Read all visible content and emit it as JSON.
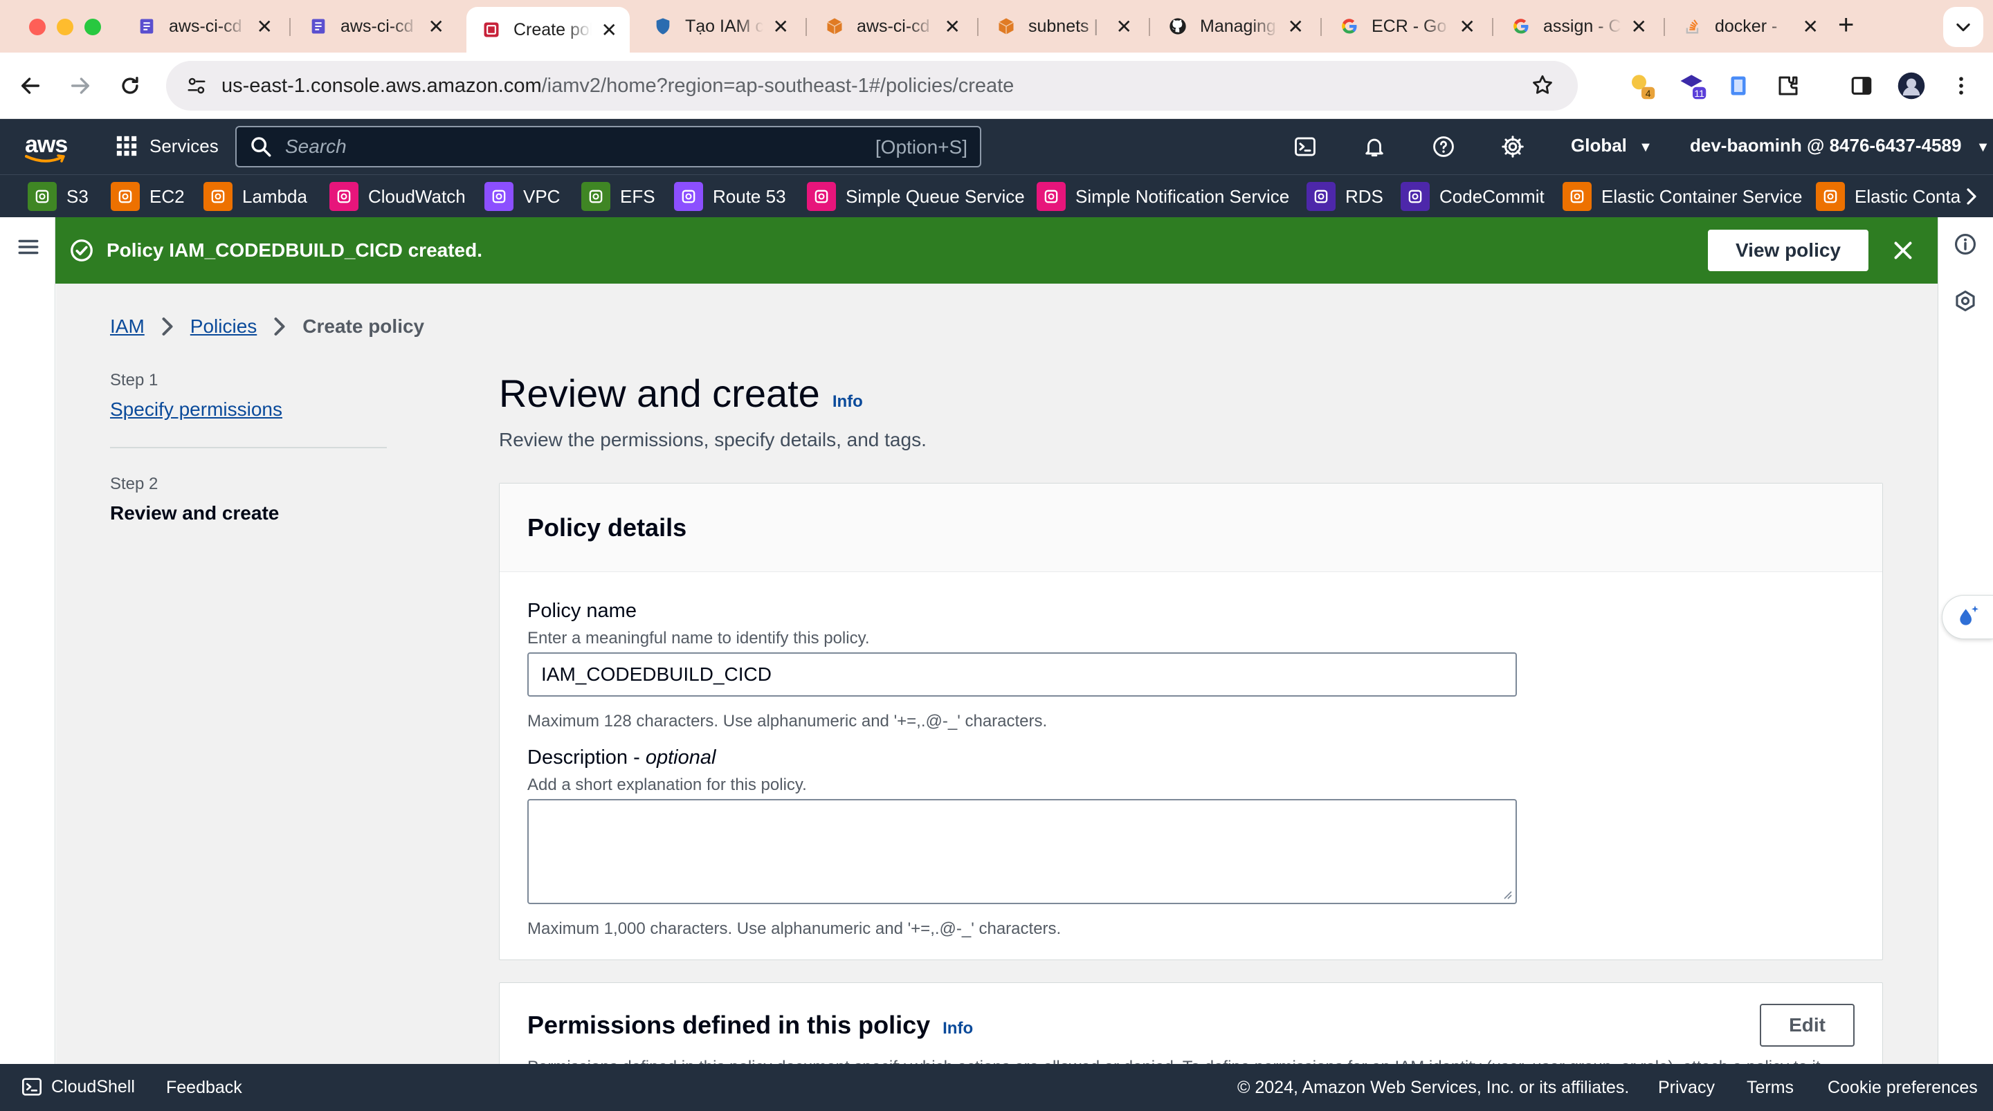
{
  "browser": {
    "tabs": [
      {
        "title": "aws-ci-cd",
        "icon": "codecommit-icon",
        "color": "#5a4fcf"
      },
      {
        "title": "aws-ci-cd",
        "icon": "codecommit-icon",
        "color": "#5a4fcf"
      },
      {
        "title": "Create policy",
        "icon": "iam-icon",
        "color": "#c7223a",
        "active": true
      },
      {
        "title": "Tạo IAM c",
        "icon": "shield-icon",
        "color": "#2b6cb0"
      },
      {
        "title": "aws-ci-cd",
        "icon": "cube-icon",
        "color": "#e07b24"
      },
      {
        "title": "subnets | ",
        "icon": "cube-icon",
        "color": "#e07b24"
      },
      {
        "title": "Managing",
        "icon": "github-icon",
        "color": "#1f1f1f"
      },
      {
        "title": "ECR - Go",
        "icon": "google-icon",
        "color": "#4285f4"
      },
      {
        "title": "assign - C",
        "icon": "google-icon",
        "color": "#4285f4"
      },
      {
        "title": "docker - ",
        "icon": "stackoverflow-icon",
        "color": "#f48024"
      }
    ],
    "url_host": "us-east-1.console.aws.amazon.com",
    "url_path": "/iamv2/home?region=ap-southeast-1#/policies/create",
    "ext_badge_1": "4",
    "ext_badge_2": "11"
  },
  "aws_nav": {
    "logo": "aws",
    "services_label": "Services",
    "search_placeholder": "Search",
    "search_shortcut": "[Option+S]",
    "region": "Global",
    "account": "dev-baominh @ 8476-6437-4589"
  },
  "favorites": [
    {
      "label": "S3",
      "color": "#3f8624"
    },
    {
      "label": "EC2",
      "color": "#ed7100"
    },
    {
      "label": "Lambda",
      "color": "#ed7100"
    },
    {
      "label": "CloudWatch",
      "color": "#e7157b"
    },
    {
      "label": "VPC",
      "color": "#8c4fff"
    },
    {
      "label": "EFS",
      "color": "#3f8624"
    },
    {
      "label": "Route 53",
      "color": "#8c4fff"
    },
    {
      "label": "Simple Queue Service",
      "color": "#e7157b"
    },
    {
      "label": "Simple Notification Service",
      "color": "#e7157b"
    },
    {
      "label": "RDS",
      "color": "#4d27aa"
    },
    {
      "label": "CodeCommit",
      "color": "#4d27aa"
    },
    {
      "label": "Elastic Container Service",
      "color": "#ed7100"
    },
    {
      "label": "Elastic Conta",
      "color": "#ed7100"
    }
  ],
  "flash": {
    "message": "Policy IAM_CODEDBUILD_CICD created.",
    "button": "View policy",
    "color": "#2e7d22"
  },
  "breadcrumbs": {
    "iam": "IAM",
    "policies": "Policies",
    "current": "Create policy"
  },
  "steps": {
    "step1_label": "Step 1",
    "step1_title": "Specify permissions",
    "step2_label": "Step 2",
    "step2_title": "Review and create"
  },
  "page": {
    "title": "Review and create",
    "info": "Info",
    "subtitle": "Review the permissions, specify details, and tags."
  },
  "policy_details": {
    "heading": "Policy details",
    "name_label": "Policy name",
    "name_desc": "Enter a meaningful name to identify this policy.",
    "name_value": "IAM_CODEDBUILD_CICD",
    "name_hint": "Maximum 128 characters. Use alphanumeric and '+=,.@-_' characters.",
    "desc_label": "Description - ",
    "desc_optional": "optional",
    "desc_desc": "Add a short explanation for this policy.",
    "desc_value": "",
    "desc_hint": "Maximum 1,000 characters. Use alphanumeric and '+=,.@-_' characters."
  },
  "permissions": {
    "heading": "Permissions defined in this policy",
    "info": "Info",
    "edit": "Edit",
    "desc": "Permissions defined in this policy document specify which actions are allowed or denied. To define permissions for an IAM identity (user, user group, or role), attach a policy to it."
  },
  "footer": {
    "cloudshell": "CloudShell",
    "feedback": "Feedback",
    "copyright": "© 2024, Amazon Web Services, Inc. or its affiliates.",
    "privacy": "Privacy",
    "terms": "Terms",
    "cookies": "Cookie preferences"
  }
}
